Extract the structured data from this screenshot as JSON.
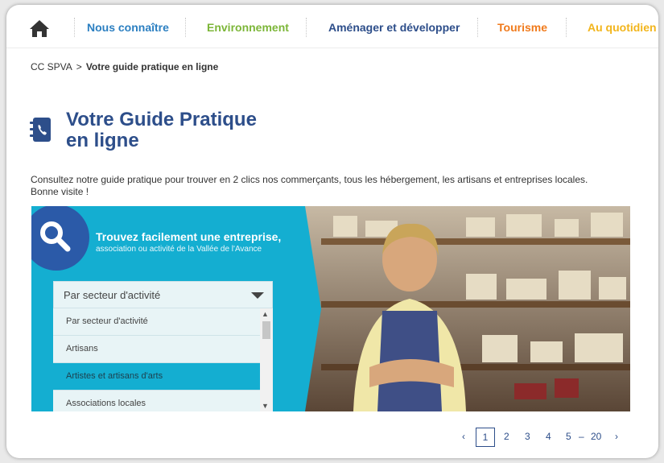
{
  "nav": {
    "items": [
      {
        "label": "Nous connaître",
        "color": "#2b7fc1"
      },
      {
        "label": "Environnement",
        "color": "#7cb638"
      },
      {
        "label": "Aménager et développer",
        "color": "#2d4e8a"
      },
      {
        "label": "Tourisme",
        "color": "#f07a1b"
      },
      {
        "label": "Au quotidien",
        "color": "#f2b51c"
      }
    ]
  },
  "breadcrumb": {
    "root": "CC SPVA",
    "separator": ">",
    "current": "Votre guide pratique en ligne"
  },
  "page": {
    "title_line1": "Votre Guide Pratique",
    "title_line2": "en ligne",
    "intro_line1": "Consultez notre guide pratique pour trouver en 2 clics nos commerçants, tous les hébergement, les artisans et entreprises locales.",
    "intro_line2": "Bonne visite !"
  },
  "banner": {
    "title": "Trouvez facilement une entreprise,",
    "subtitle": "association ou activité de la Vallée de l'Avance",
    "select_value": "Par secteur d'activité",
    "options": [
      "Par secteur d'activité",
      "Artisans",
      "Artistes et artisans d'arts",
      "Associations locales"
    ],
    "highlighted_option": "Artistes et artisans d'arts",
    "accent_color": "#14aed1",
    "circle_color": "#2b5aa8"
  },
  "pagination": {
    "prev": "‹",
    "current": "1",
    "pages": [
      "2",
      "3",
      "4",
      "5"
    ],
    "ellipsis": "–",
    "last": "20",
    "next": "›"
  },
  "icons": [
    "home-icon",
    "phone-book-icon",
    "search-icon",
    "chevron-down-icon"
  ]
}
